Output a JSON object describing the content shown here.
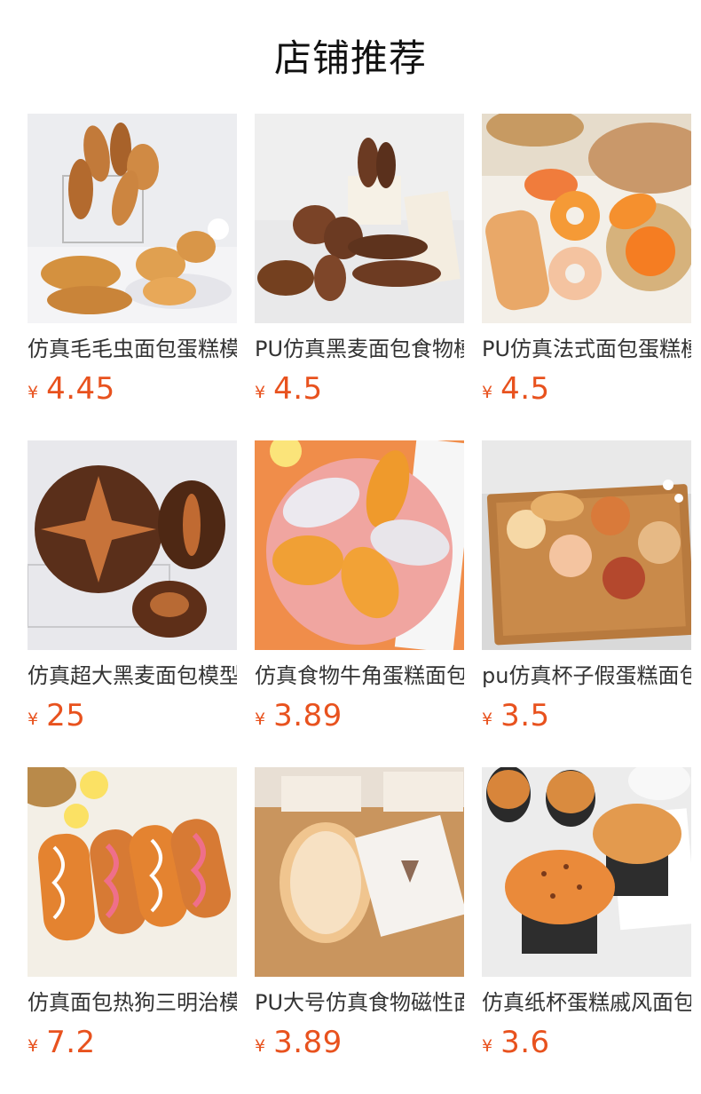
{
  "page": {
    "title": "店铺推荐"
  },
  "colors": {
    "price": "#e8521e",
    "title": "#111111",
    "name": "#333333"
  },
  "products": [
    {
      "name": "仿真毛毛虫面包蛋糕模型",
      "currency": "¥",
      "price": "4.45",
      "image": "bread-basket-photo"
    },
    {
      "name": "PU仿真黑麦面包食物模型",
      "currency": "¥",
      "price": "4.5",
      "image": "rye-bread-photo"
    },
    {
      "name": "PU仿真法式面包蛋糕模型",
      "currency": "¥",
      "price": "4.5",
      "image": "french-pastry-photo"
    },
    {
      "name": "仿真超大黑麦面包模型",
      "currency": "¥",
      "price": "25",
      "image": "large-rye-loaf-photo"
    },
    {
      "name": "仿真食物牛角蛋糕面包模型",
      "currency": "¥",
      "price": "3.89",
      "image": "croissant-plate-photo"
    },
    {
      "name": "pu仿真杯子假蛋糕面包模型",
      "currency": "¥",
      "price": "3.5",
      "image": "cupcake-tray-photo"
    },
    {
      "name": "仿真面包热狗三明治模型",
      "currency": "¥",
      "price": "7.2",
      "image": "hotdog-sandwich-photo"
    },
    {
      "name": "PU大号仿真食物磁性面包",
      "currency": "¥",
      "price": "3.89",
      "image": "paper-wrapped-bread-photo"
    },
    {
      "name": "仿真纸杯蛋糕戚风面包模型",
      "currency": "¥",
      "price": "3.6",
      "image": "muffin-cup-photo"
    }
  ]
}
